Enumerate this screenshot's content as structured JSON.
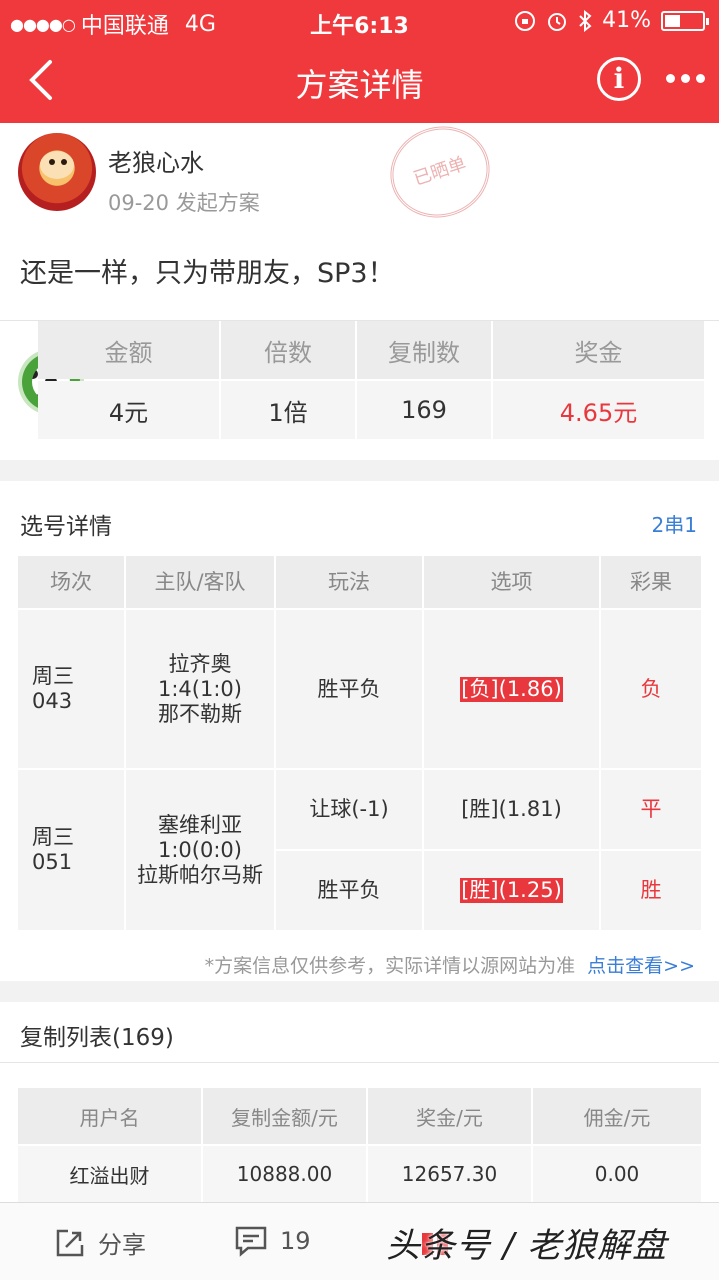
{
  "status_bar": {
    "carrier": "中国联通",
    "network": "4G",
    "time": "上午6:13",
    "battery": "41%",
    "battery_level": 0.41
  },
  "nav": {
    "title": "方案详情"
  },
  "author": {
    "name": "老狼心水",
    "date_action": "09-20 发起方案",
    "stamp": "已晒单"
  },
  "plan_text": "还是一样，只为带朋友，SP3！",
  "summary": {
    "headers": [
      "金额",
      "倍数",
      "复制数",
      "奖金"
    ],
    "values": [
      "4元",
      "1倍",
      "169",
      "4.65元"
    ]
  },
  "detail": {
    "title": "选号详情",
    "combo": "2串1",
    "headers": [
      "场次",
      "主队/客队",
      "玩法",
      "选项",
      "彩果"
    ],
    "matches": [
      {
        "session": "周三\n043",
        "teams": "拉齐奥\n1:4(1:0)\n那不勒斯",
        "bets": [
          {
            "play": "胜平负",
            "pick": "[负](1.86)",
            "result": "负",
            "hit": true
          }
        ]
      },
      {
        "session": "周三\n051",
        "teams": "塞维利亚\n1:0(0:0)\n拉斯帕尔马斯",
        "bets": [
          {
            "play": "让球(-1)",
            "pick": "[胜](1.81)",
            "result": "平",
            "hit": false
          },
          {
            "play": "胜平负",
            "pick": "[胜](1.25)",
            "result": "胜",
            "hit": true
          }
        ]
      }
    ],
    "note": "*方案信息仅供参考，实际详情以源网站为准",
    "link": "点击查看>>"
  },
  "copy_list": {
    "title": "复制列表(169)",
    "headers": [
      "用户名",
      "复制金额/元",
      "奖金/元",
      "佣金/元"
    ],
    "rows": [
      [
        "红溢出财",
        "10888.00",
        "12657.30",
        "0.00"
      ]
    ]
  },
  "bottom_bar": {
    "share": "分享",
    "comments": "19"
  },
  "watermark": "头条号 / 老狼解盘",
  "colors": {
    "brand_red": "#f0393c",
    "hit_red": "#e8383d",
    "link_blue": "#3a7ed6"
  }
}
